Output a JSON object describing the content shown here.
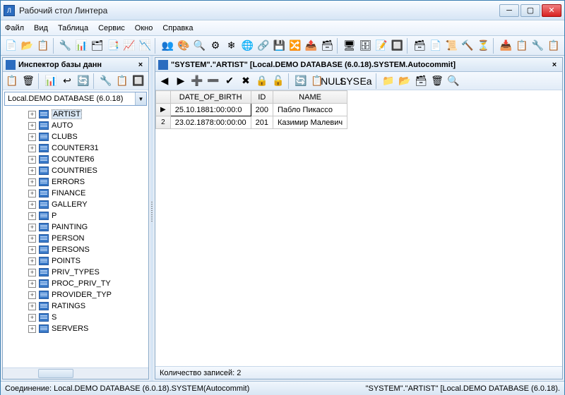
{
  "window": {
    "title": "Рабочий стол Линтера"
  },
  "menu": [
    "Файл",
    "Вид",
    "Таблица",
    "Сервис",
    "Окно",
    "Справка"
  ],
  "inspector": {
    "title": "Инспектор базы данн",
    "combo": "Local.DEMO DATABASE (6.0.18)",
    "tables": [
      "ARTIST",
      "AUTO",
      "CLUBS",
      "COUNTER31",
      "COUNTER6",
      "COUNTRIES",
      "ERRORS",
      "FINANCE",
      "GALLERY",
      "P",
      "PAINTING",
      "PERSON",
      "PERSONS",
      "POINTS",
      "PRIV_TYPES",
      "PROC_PRIV_TY",
      "PROVIDER_TYP",
      "RATINGS",
      "S",
      "SERVERS"
    ],
    "selected": "ARTIST"
  },
  "editor": {
    "title": "\"SYSTEM\".\"ARTIST\" [Local.DEMO DATABASE (6.0.18).SYSTEM.Autocommit]",
    "columns": [
      "DATE_OF_BIRTH",
      "ID",
      "NAME"
    ],
    "rows": [
      {
        "marker": "▶",
        "cells": [
          "25.10.1881:00:00:0",
          "200",
          "Пабло Пикассо"
        ]
      },
      {
        "marker": "2",
        "cells": [
          "23.02.1878:00:00:00",
          "201",
          "Казимир Малевич"
        ]
      }
    ],
    "status": "Количество записей: 2"
  },
  "footer": {
    "left": "Соединение: Local.DEMO DATABASE (6.0.18).SYSTEM(Autocommit)",
    "right": "\"SYSTEM\".\"ARTIST\" [Local.DEMO DATABASE (6.0.18)."
  },
  "icons": {
    "main_toolbar": [
      "📄",
      "📂",
      "📋",
      "🔧",
      "📊",
      "🗂",
      "📑",
      "📈",
      "📉",
      "👥",
      "🎨",
      "🔍",
      "⚙",
      "❄",
      "🌐",
      "🔗",
      "💾",
      "🔀",
      "📤",
      "🗃",
      "🖥",
      "🗄",
      "📝",
      "🔲",
      "🗃",
      "📄",
      "📜",
      "🔨",
      "⏳",
      "📥",
      "📋",
      "🔧",
      "📋"
    ],
    "inspector_tb": [
      "📋",
      "🗑",
      "📊",
      "↩",
      "🔄",
      "🔧",
      "📋",
      "🔲"
    ],
    "editor_tb": [
      "◀",
      "▶",
      "➕",
      "➖",
      "✔",
      "✖",
      "🔒",
      "🔓",
      "🔄",
      "📋",
      "NULL",
      "SYS",
      "Ea",
      "📁",
      "📂",
      "🗃",
      "🗑",
      "🔍"
    ]
  }
}
